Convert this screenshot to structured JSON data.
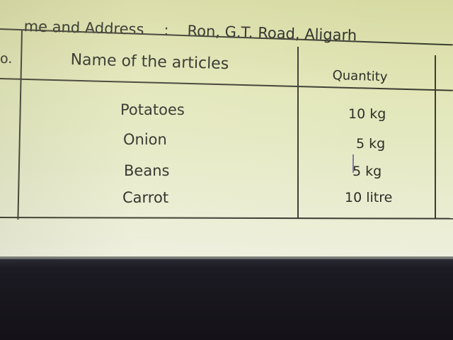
{
  "header": {
    "label": "me and Address",
    "separator": ":",
    "value": "Ron, G.T. Road, Aligarh"
  },
  "table": {
    "serial_header_fragment": "o.",
    "columns": [
      "Name of the articles",
      "Quantity"
    ],
    "rows": [
      {
        "article": "Potatoes",
        "quantity": "10 kg"
      },
      {
        "article": "Onion",
        "quantity": "5 kg"
      },
      {
        "article": "Beans",
        "quantity": "5 kg"
      },
      {
        "article": "Carrot",
        "quantity": "10 litre"
      }
    ]
  }
}
